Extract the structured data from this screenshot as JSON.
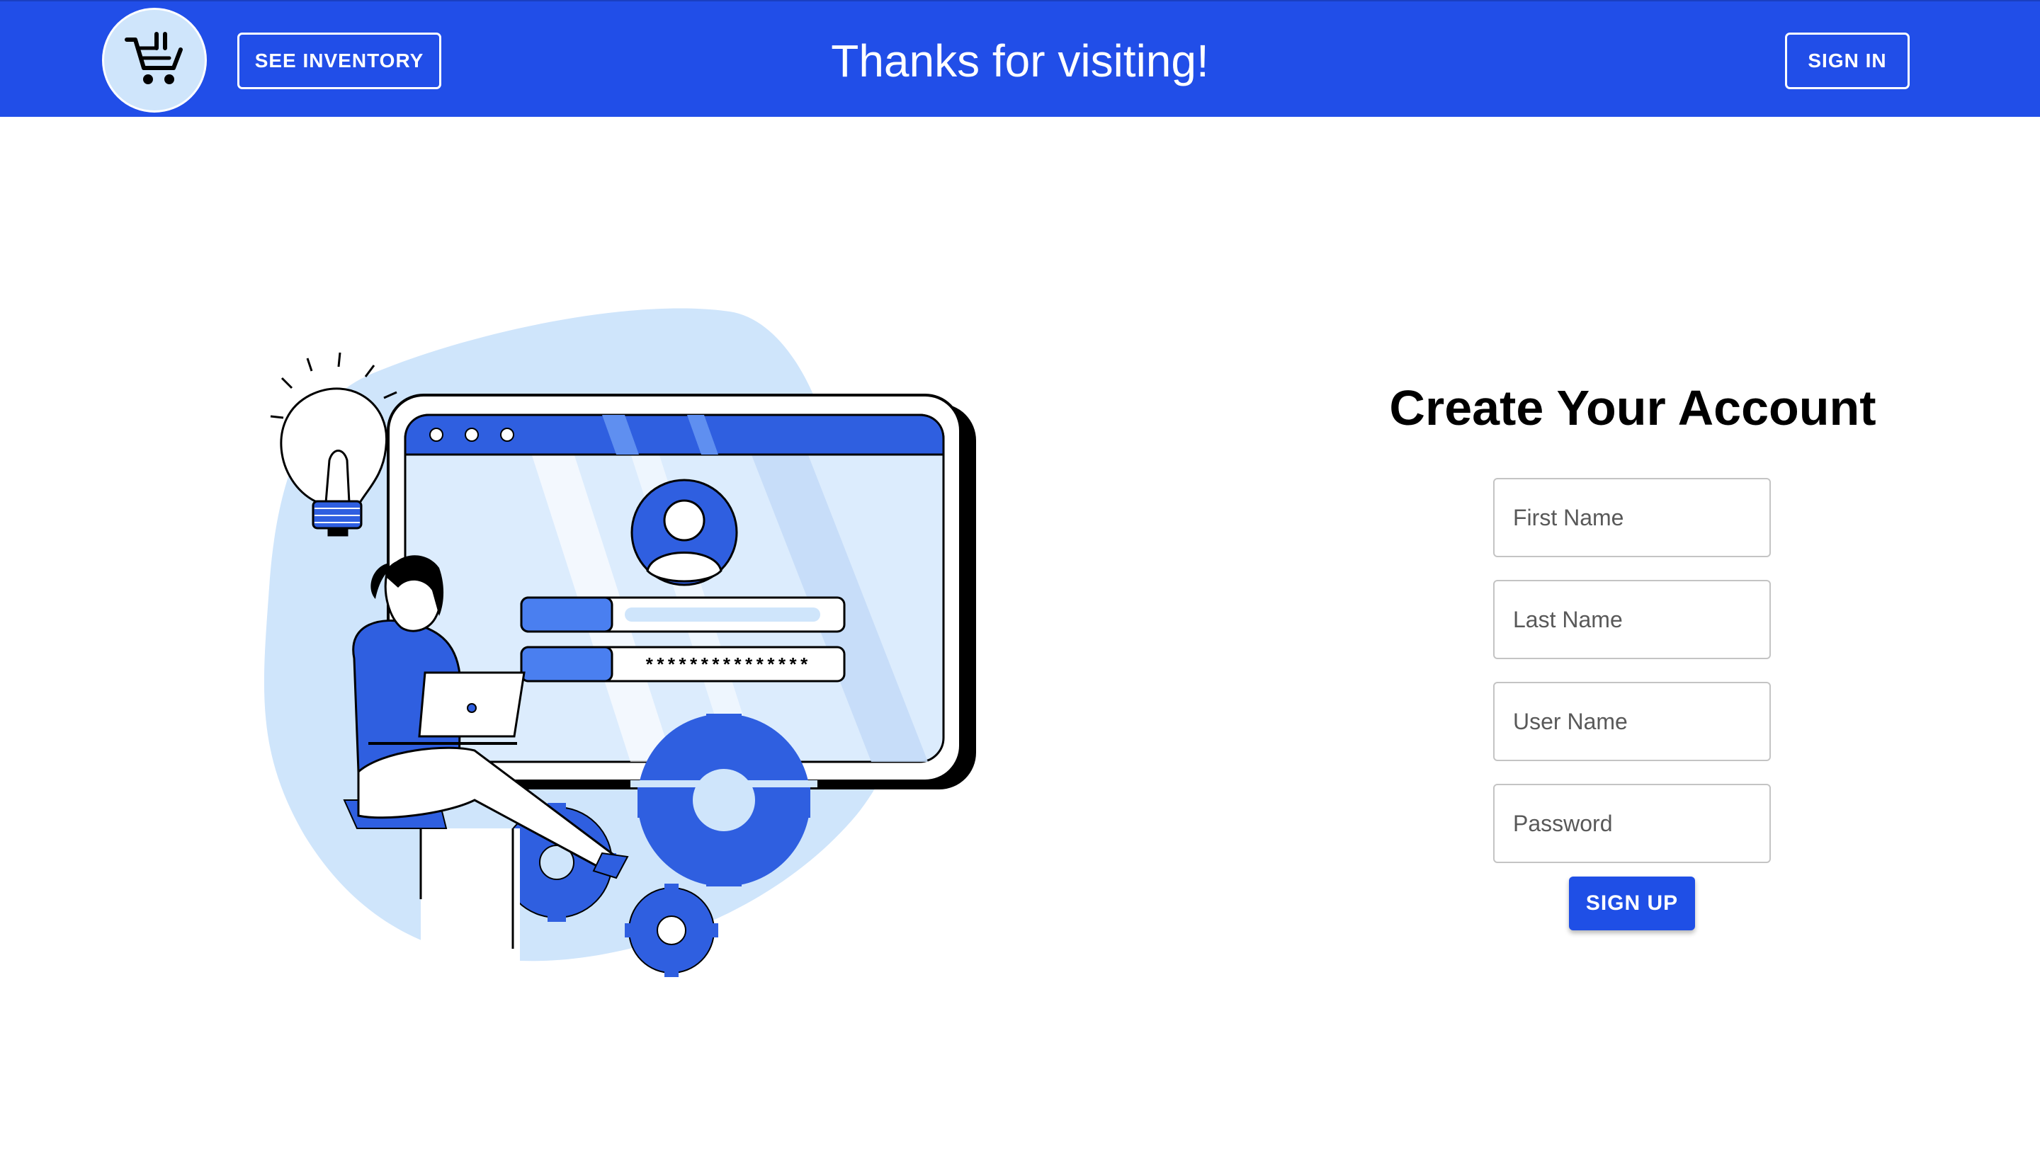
{
  "header": {
    "logo_icon": "shopping-cart-icon",
    "see_inventory_label": "SEE INVENTORY",
    "title": "Thanks for visiting!",
    "sign_in_label": "SIGN IN"
  },
  "illustration": {
    "password_mask": "***************"
  },
  "signup_form": {
    "title": "Create Your Account",
    "fields": [
      {
        "placeholder": "First Name"
      },
      {
        "placeholder": "Last Name"
      },
      {
        "placeholder": "User Name"
      },
      {
        "placeholder": "Password"
      }
    ],
    "submit_label": "SIGN UP"
  },
  "colors": {
    "primary": "#214ee8",
    "logo_background": "#cfe5fb",
    "illustration_blob": "#cfe5fb"
  }
}
